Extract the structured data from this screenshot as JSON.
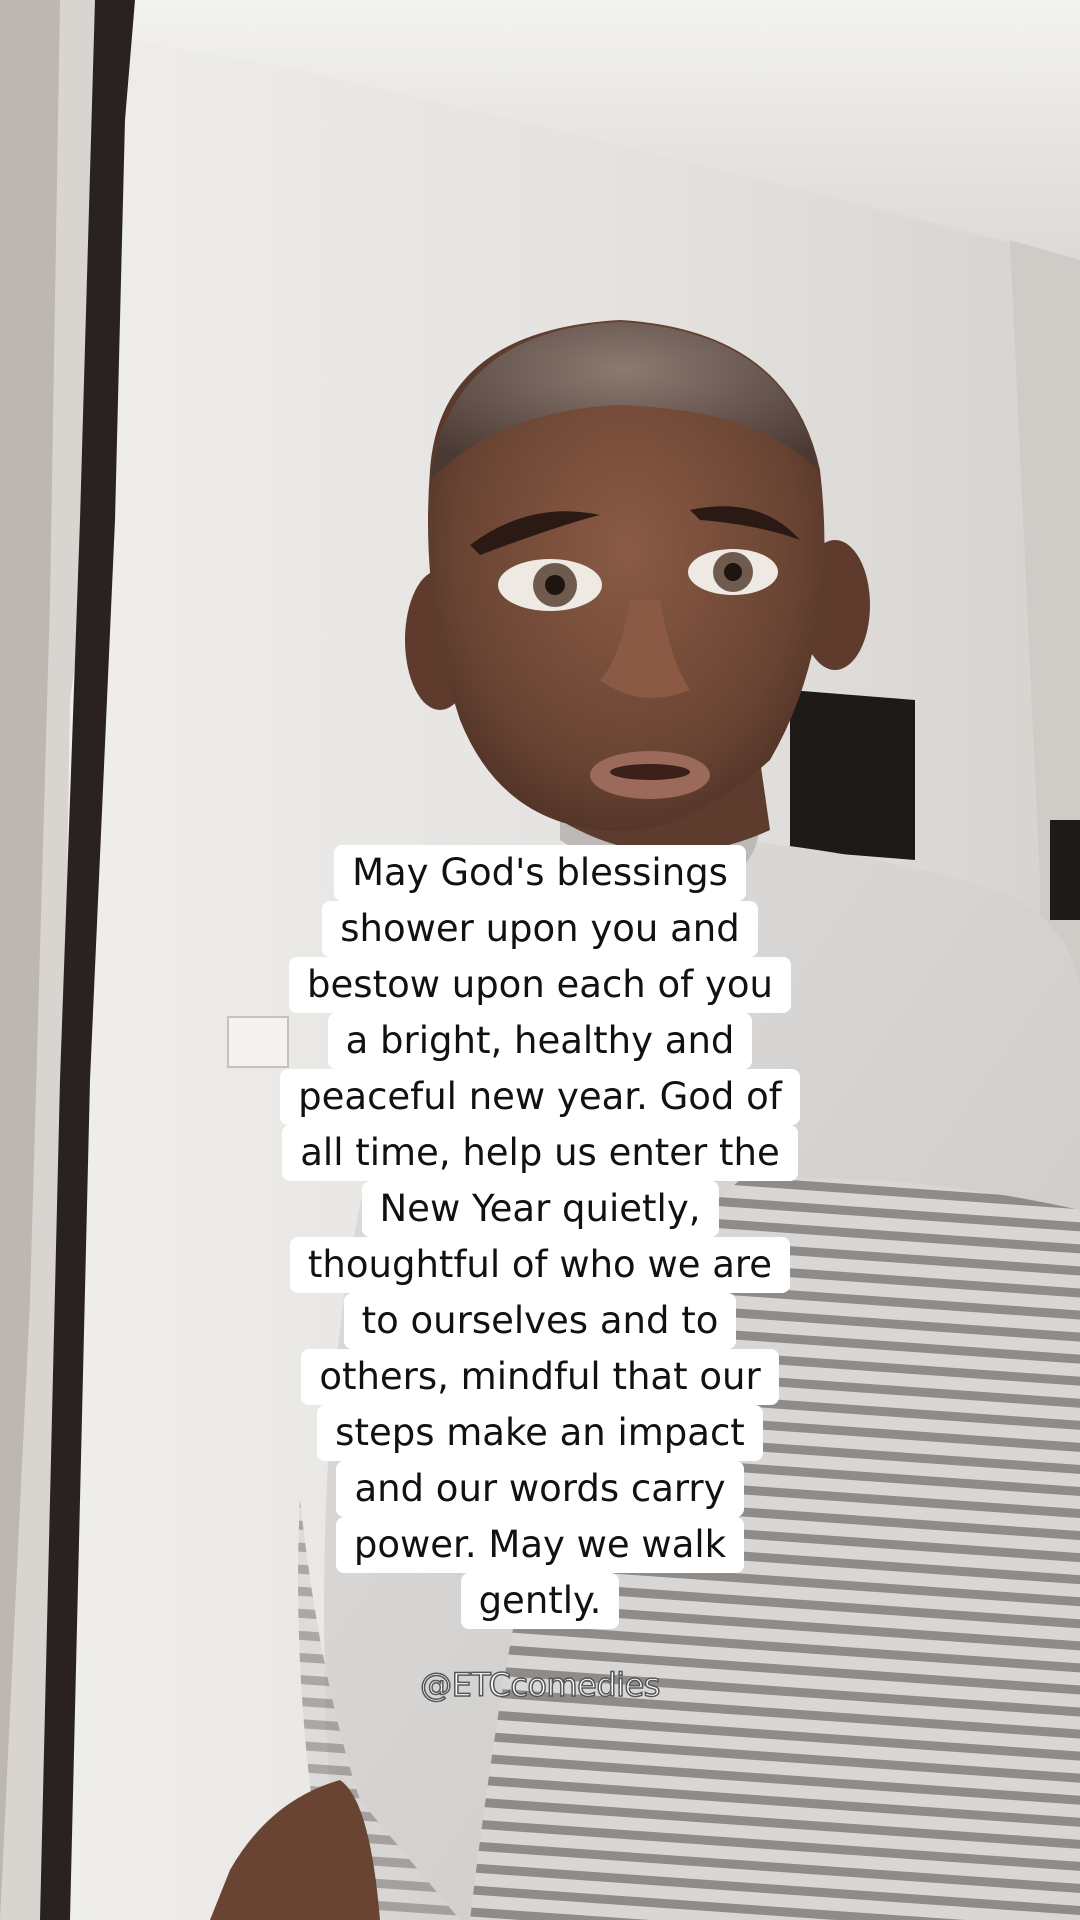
{
  "caption": {
    "lines": [
      "May God's blessings",
      "shower upon you and",
      "bestow upon each of you",
      "a bright, healthy and",
      "peaceful new year. God of",
      "all time, help us enter the",
      "New Year quietly,",
      "thoughtful of who we are",
      "to ourselves and to",
      "others, mindful that our",
      "steps make an impact",
      "and our words carry",
      "power. May we walk",
      "gently."
    ]
  },
  "watermark": {
    "handle": "@ETCcomedies"
  },
  "colors": {
    "wall": "#e6e4e1",
    "ceiling": "#ecebe8",
    "door_frame": "#2a2220",
    "skin": "#6b4636",
    "shirt": "#d8d6d4",
    "shirt_stripe": "#8f8c8a",
    "caption_bg": "#ffffff",
    "caption_text": "#111111"
  }
}
